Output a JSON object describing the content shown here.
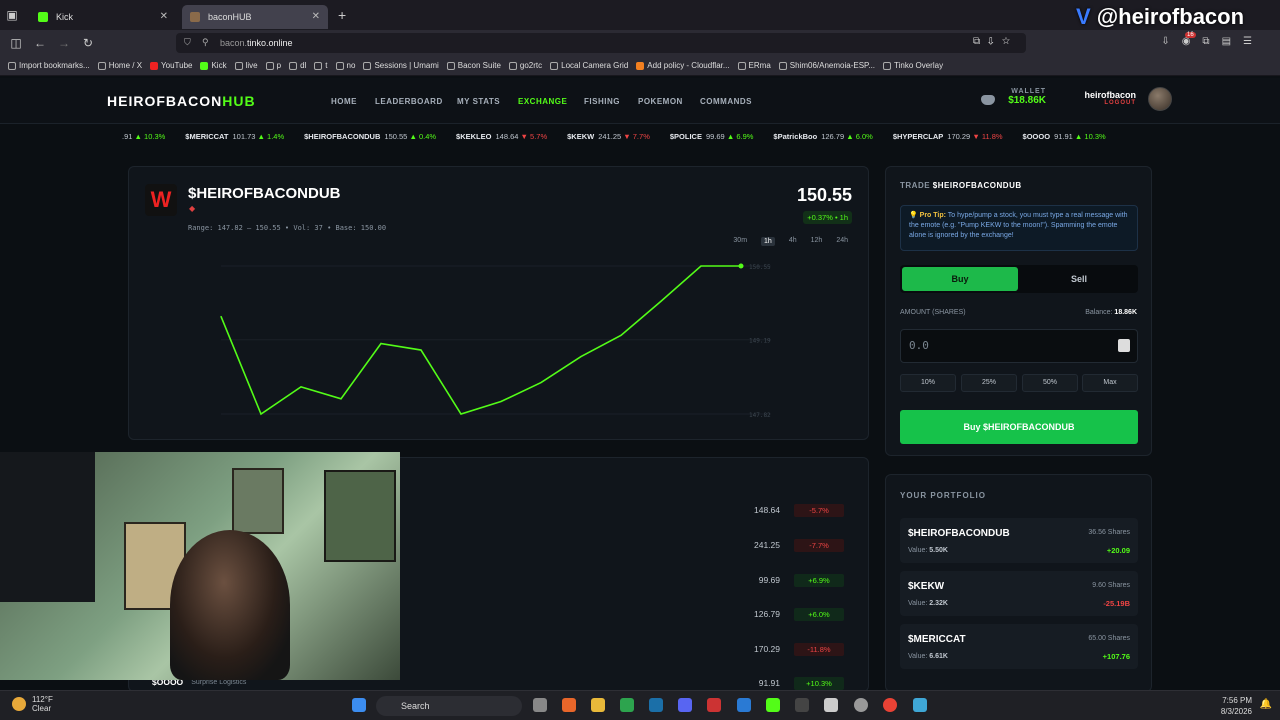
{
  "browser": {
    "tabs": [
      {
        "label": "Kick",
        "active": false,
        "color": "#53fc18"
      },
      {
        "label": "baconHUB",
        "active": true,
        "color": "#8a6a4a"
      }
    ],
    "url_prefix": "bacon.",
    "url_domain": "tinko.online",
    "bookmarks": [
      "Import bookmarks...",
      "Home / X",
      "YouTube",
      "Kick",
      "live",
      "p",
      "dl",
      "t",
      "no",
      "Sessions | Umami",
      "Bacon Suite",
      "go2rtc",
      "Local Camera Grid",
      "Add policy - Cloudflar...",
      "ERma",
      "Shim06/Anemoia-ESP...",
      "Tinko Overlay"
    ],
    "new_tab": "+",
    "notif_count": "16"
  },
  "stream_overlay": {
    "brand_mark": "V",
    "handle": "@heirofbacon"
  },
  "site": {
    "logo_main": "HEIROFBACON",
    "logo_accent": "HUB",
    "nav": [
      "HOME",
      "LEADERBOARD",
      "MY STATS",
      "EXCHANGE",
      "FISHING",
      "POKEMON",
      "COMMANDS"
    ],
    "active_nav": "EXCHANGE",
    "wallet_label": "WALLET",
    "wallet_value": "$18.86K",
    "username": "heirofbacon",
    "logout": "LOGOUT"
  },
  "ticker": [
    {
      "sym": "",
      "price": ".91",
      "chg": "▲ 10.3%",
      "dir": "up"
    },
    {
      "sym": "$MERICCAT",
      "price": "101.73",
      "chg": "▲ 1.4%",
      "dir": "up"
    },
    {
      "sym": "$HEIROFBACONDUB",
      "price": "150.55",
      "chg": "▲ 0.4%",
      "dir": "up"
    },
    {
      "sym": "$KEKLEO",
      "price": "148.64",
      "chg": "▼ 5.7%",
      "dir": "dn"
    },
    {
      "sym": "$KEKW",
      "price": "241.25",
      "chg": "▼ 7.7%",
      "dir": "dn"
    },
    {
      "sym": "$POLICE",
      "price": "99.69",
      "chg": "▲ 6.9%",
      "dir": "up"
    },
    {
      "sym": "$PatrickBoo",
      "price": "126.79",
      "chg": "▲ 6.0%",
      "dir": "up"
    },
    {
      "sym": "$HYPERCLAP",
      "price": "170.29",
      "chg": "▼ 11.8%",
      "dir": "dn"
    },
    {
      "sym": "$OOOO",
      "price": "91.91",
      "chg": "▲ 10.3%",
      "dir": "up"
    }
  ],
  "stock": {
    "logo_letter": "W",
    "name": "$HEIROFBACONDUB",
    "sub_icon": "diamond-icon",
    "meta": "Range: 147.82 — 150.55  •  Vol: 37  •  Base: 150.00",
    "price": "150.55",
    "change": "+0.37% • 1h",
    "ranges": [
      "30m",
      "1h",
      "4h",
      "12h",
      "24h"
    ],
    "active_range": "1h"
  },
  "chart_data": {
    "type": "line",
    "title": "",
    "y_ticks": [
      "150.55",
      "149.19",
      "147.82"
    ],
    "ylim": [
      147.82,
      150.55
    ],
    "x": [
      0,
      1,
      2,
      3,
      4,
      5,
      6,
      7,
      8,
      9,
      10,
      11,
      12,
      13
    ],
    "series": [
      {
        "values": [
          149.62,
          147.82,
          148.32,
          148.1,
          149.12,
          149.0,
          147.82,
          148.05,
          148.4,
          148.88,
          149.27,
          149.9,
          150.55,
          150.55
        ]
      }
    ],
    "line_color": "#53fc18"
  },
  "market_rows": [
    {
      "price": "148.64",
      "chg": "-5.7%",
      "dir": "dn"
    },
    {
      "price": "241.25",
      "chg": "-7.7%",
      "dir": "dn"
    },
    {
      "price": "99.69",
      "chg": "+6.9%",
      "dir": "up"
    },
    {
      "price": "126.79",
      "chg": "+6.0%",
      "dir": "up"
    },
    {
      "price": "170.29",
      "chg": "-11.8%",
      "dir": "dn"
    },
    {
      "price": "91.91",
      "chg": "+10.3%",
      "dir": "up"
    }
  ],
  "bottom_row": {
    "sym": "$OOOO",
    "name": "Surprise Logistics"
  },
  "trade": {
    "title_prefix": "TRADE",
    "title_sym": "$HEIROFBACONDUB",
    "tip_label": "💡 Pro Tip:",
    "tip_text": " To hype/pump a stock, you must type a real message with the emote (e.g. \"Pump KEKW to the moon!\"). Spamming the emote alone is ignored by the exchange!",
    "buy": "Buy",
    "sell": "Sell",
    "amount_label": "AMOUNT (SHARES)",
    "balance_label": "Balance: ",
    "balance_value": "18.86K",
    "amount_placeholder": "0.0",
    "pcts": [
      "10%",
      "25%",
      "50%",
      "Max"
    ],
    "action": "Buy $HEIROFBACONDUB"
  },
  "portfolio": {
    "title": "YOUR PORTFOLIO",
    "items": [
      {
        "sym": "$HEIROFBACONDUB",
        "shares": "36.56 Shares",
        "value": "5.50K",
        "pl": "+20.09",
        "dir": "up"
      },
      {
        "sym": "$KEKW",
        "shares": "9.60 Shares",
        "value": "2.32K",
        "pl": "-25.19B",
        "dir": "dn"
      },
      {
        "sym": "$MERICCAT",
        "shares": "65.00 Shares",
        "value": "6.61K",
        "pl": "+107.76",
        "dir": "up"
      }
    ],
    "value_label": "Value: "
  },
  "taskbar": {
    "temp": "112°F",
    "weather": "Clear",
    "search": "Search",
    "time": "7:56 PM",
    "date": "8/3/2026"
  }
}
